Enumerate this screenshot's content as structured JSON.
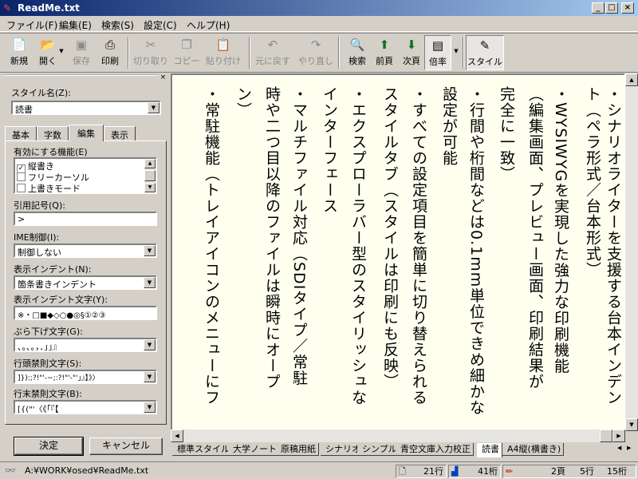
{
  "window": {
    "title": "ReadMe.txt",
    "minimize": "_",
    "maximize": "□",
    "close": "×"
  },
  "menu": [
    "ファイル(F)",
    "編集(E)",
    "検索(S)",
    "設定(C)",
    "ヘルプ(H)"
  ],
  "toolbar": {
    "new": "新規",
    "open": "開く",
    "save": "保存",
    "print": "印刷",
    "cut": "切り取り",
    "copy": "コピー",
    "paste": "貼り付け",
    "undo": "元に戻す",
    "redo": "やり直し",
    "search": "検索",
    "prev_page": "前頁",
    "next_page": "次頁",
    "zoom": "倍率",
    "style": "スタイル"
  },
  "panel": {
    "close": "×",
    "style_name_label": "スタイル名(Z):",
    "style_name_value": "読書",
    "tabs": [
      "基本",
      "字数",
      "編集",
      "表示"
    ],
    "active_tab": "編集",
    "features_label": "有効にする機能(E)",
    "features": [
      {
        "label": "縦書き",
        "checked": true
      },
      {
        "label": "フリーカーソル",
        "checked": false
      },
      {
        "label": "上書きモード",
        "checked": false
      }
    ],
    "quote_label": "引用記号(Q):",
    "quote_value": ">",
    "ime_label": "IME制御(I):",
    "ime_value": "制御しない",
    "indent_label": "表示インデント(N):",
    "indent_value": "箇条書きインデント",
    "indent_chars_label": "表示インデント文字(Y):",
    "indent_chars_value": "※・□■◆◇○●◎§①②③",
    "hang_label": "ぶら下げ文字(G):",
    "hang_value": "､｡､｡，．」」』",
    "line_head_label": "行頭禁則文字(S):",
    "line_head_value": "]}):;?!\"'-~;:?!\"'-\"'」』】》〉",
    "line_end_label": "行末禁則文字(B):",
    "line_end_value": "[{(\"'〈《「『【",
    "ok": "決定",
    "cancel": "キャンセル"
  },
  "document": {
    "lines": [
      "・シナリオライターを支援する台本インデン",
      "ト（ペラ形式／台本形式）",
      "・WYSIWYGを実現した強力な印刷機能",
      "（編集画面、プレビュー画面、印刷結果が",
      "完全に一致）",
      "・行間や桁間などは0.1mm単位できめ細かな",
      "設定が可能",
      "・すべての設定項目を簡単に切り替えられる",
      "スタイルタブ（スタイルは印刷にも反映）",
      "・エクスプローラバー型のスタイリッシュな",
      "インターフェース",
      "・マルチファイル対応（SDIタイプ／常駐",
      "時や二つ目以降のファイルは瞬時にオープ",
      "ン）",
      "・常駐機能（トレイアイコンのメニューにフ"
    ]
  },
  "style_tabs": [
    "標準スタイル",
    "大学ノート",
    "原稿用紙",
    "シナリオ",
    "シンプル",
    "青空文庫入力校正",
    "読書",
    "A4縦(横書き)"
  ],
  "active_style_tab": "読書",
  "status": {
    "path": "A:¥WORK¥osed¥ReadMe.txt",
    "lines": "21行",
    "columns": "41桁",
    "page": "2頁",
    "row": "5行",
    "col": "15桁"
  },
  "colors": {
    "title_start": "#0a246a",
    "title_end": "#a6caf0",
    "paper": "#fffff0",
    "face": "#d4d0c8"
  }
}
